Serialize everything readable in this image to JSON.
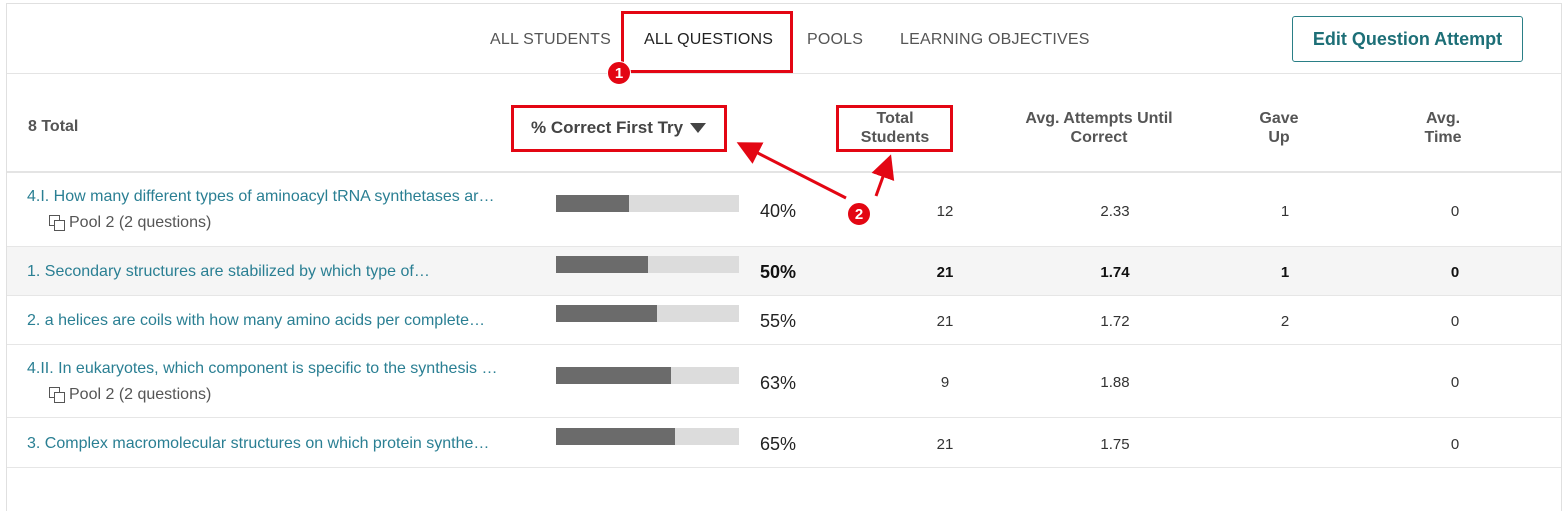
{
  "tabs": [
    {
      "label": "ALL STUDENTS"
    },
    {
      "label": "ALL QUESTIONS"
    },
    {
      "label": "POOLS"
    },
    {
      "label": "LEARNING OBJECTIVES"
    }
  ],
  "edit_button": "Edit Question Attempt",
  "header": {
    "total": "8 Total",
    "sort_column": "% Correct First Try",
    "total_students": [
      "Total",
      "Students"
    ],
    "avg_attempts": [
      "Avg. Attempts Until",
      "Correct"
    ],
    "gave_up": [
      "Gave",
      "Up"
    ],
    "avg_time": [
      "Avg.",
      "Time"
    ]
  },
  "rows": [
    {
      "question": "4.I. How many different types of aminoacyl tRNA synthetases ar…",
      "pool": "Pool 2 (2 questions)",
      "correct_fraction": 0.4,
      "pct": "40%",
      "students": "12",
      "avg_attempts": "2.33",
      "gave_up": "1",
      "avg_time": "0"
    },
    {
      "question": "1. Secondary structures are stabilized by which type of…",
      "pool": "",
      "correct_fraction": 0.5,
      "pct": "50%",
      "students": "21",
      "avg_attempts": "1.74",
      "gave_up": "1",
      "avg_time": "0"
    },
    {
      "question": "2. a helices are coils with how many amino acids per complete…",
      "pool": "",
      "correct_fraction": 0.55,
      "pct": "55%",
      "students": "21",
      "avg_attempts": "1.72",
      "gave_up": "2",
      "avg_time": "0"
    },
    {
      "question": "4.II. In eukaryotes, which component is specific to the synthesis …",
      "pool": "Pool 2 (2 questions)",
      "correct_fraction": 0.63,
      "pct": "63%",
      "students": "9",
      "avg_attempts": "1.88",
      "gave_up": "",
      "avg_time": "0"
    },
    {
      "question": "3. Complex macromolecular structures on which protein synthe…",
      "pool": "",
      "correct_fraction": 0.65,
      "pct": "65%",
      "students": "21",
      "avg_attempts": "1.75",
      "gave_up": "",
      "avg_time": "0"
    }
  ],
  "annotations": {
    "badge1": "1",
    "badge2": "2",
    "color": "#e30613"
  },
  "colors": {
    "link": "#2a7f93",
    "accent": "#1d6f77",
    "bar_fill": "#6b6b6b",
    "bar_track": "#dcdcdc"
  }
}
